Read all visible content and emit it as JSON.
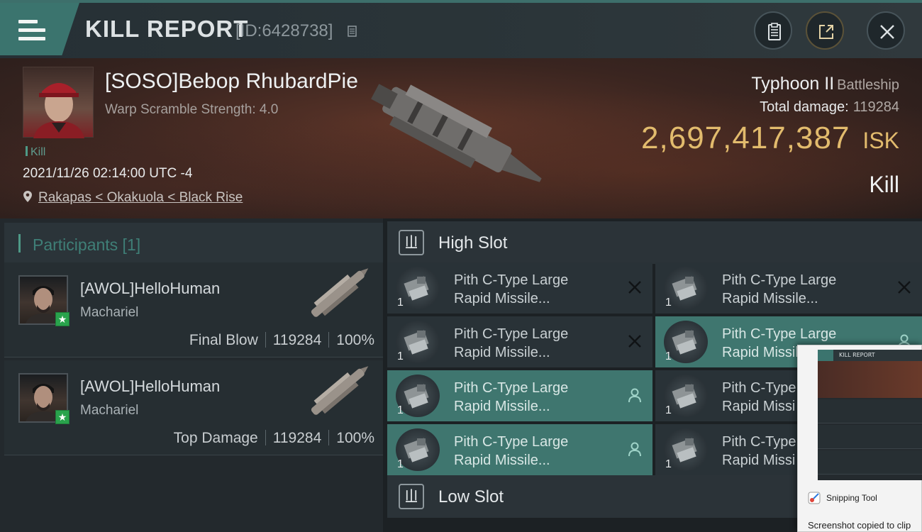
{
  "header": {
    "title": "KILL REPORT",
    "id_label": "[ID:6428738]"
  },
  "victim": {
    "name": "[SOSO]Bebop RhubardPie",
    "subtitle": "Warp Scramble Strength: 4.0",
    "tag": "Kill",
    "time": "2021/11/26 02:14:00 UTC -4",
    "location": "Rakapas < Okakuola < Black Rise"
  },
  "ship": {
    "name": "Typhoon II",
    "class": "Battleship",
    "damage_label": "Total damage:",
    "damage_value": "119284",
    "isk_value": "2,697,417,387",
    "isk_unit": "ISK",
    "result": "Kill"
  },
  "participants": {
    "title": "Participants [1]",
    "rows": [
      {
        "name": "[AWOL]HelloHuman",
        "ship": "Machariel",
        "role": "Final Blow",
        "damage": "119284",
        "percent": "100%"
      },
      {
        "name": "[AWOL]HelloHuman",
        "ship": "Machariel",
        "role": "Top Damage",
        "damage": "119284",
        "percent": "100%"
      }
    ]
  },
  "slots": {
    "high_title": "High Slot",
    "low_title": "Low Slot",
    "high_items": [
      {
        "line1": "Pith C-Type Large",
        "line2": "Rapid Missile...",
        "qty": "1",
        "state": "destroyed"
      },
      {
        "line1": "Pith C-Type Large",
        "line2": "Rapid Missile...",
        "qty": "1",
        "state": "destroyed"
      },
      {
        "line1": "Pith C-Type Large",
        "line2": "Rapid Missile...",
        "qty": "1",
        "state": "destroyed"
      },
      {
        "line1": "Pith C-Type Large",
        "line2": "Rapid Missil",
        "qty": "1",
        "state": "dropped"
      },
      {
        "line1": "Pith C-Type Large",
        "line2": "Rapid Missile...",
        "qty": "1",
        "state": "dropped"
      },
      {
        "line1": "Pith C-Type",
        "line2": "Rapid Missi",
        "qty": "1",
        "state": "destroyed"
      },
      {
        "line1": "Pith C-Type Large",
        "line2": "Rapid Missile...",
        "qty": "1",
        "state": "dropped"
      },
      {
        "line1": "Pith C-Type",
        "line2": "Rapid Missi",
        "qty": "1",
        "state": "destroyed"
      }
    ]
  },
  "toast": {
    "thumb_title": "KILL REPORT",
    "app_name": "Snipping Tool",
    "message": "Screenshot copied to clip"
  },
  "colors": {
    "accent_teal": "#3f766f",
    "isk_gold": "#e2bb6d",
    "final_blow_star": "#29a34c"
  },
  "icons": [
    "menu-icon",
    "copy-icon",
    "clipboard-icon",
    "share-icon",
    "close-icon",
    "map-pin-icon",
    "slot-icon",
    "x-mark-icon",
    "person-icon",
    "snipping-tool-icon"
  ]
}
